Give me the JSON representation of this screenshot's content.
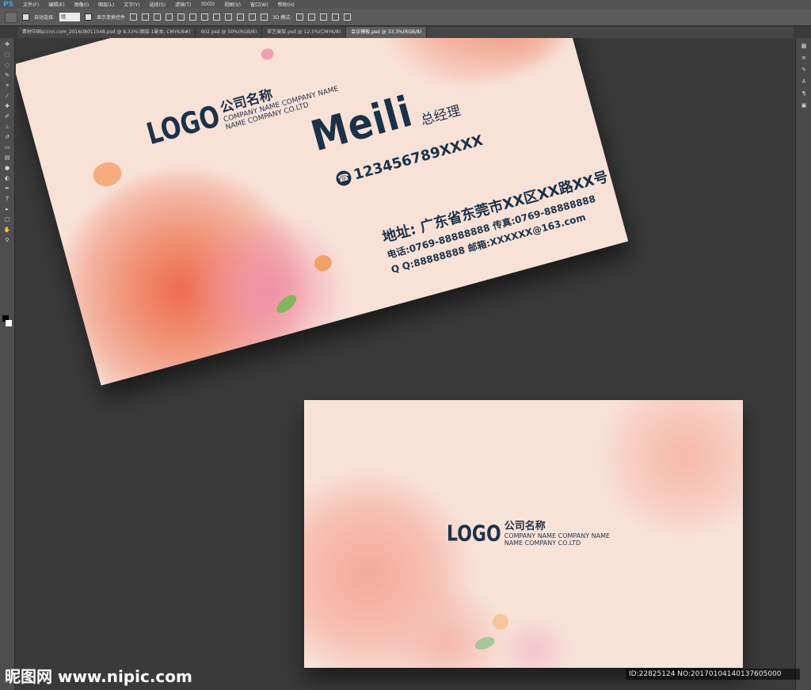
{
  "app": {
    "logo": "PS"
  },
  "menu": [
    "文件(F)",
    "编辑(E)",
    "图像(I)",
    "图层(L)",
    "文字(Y)",
    "选择(S)",
    "滤镜(T)",
    "3D(D)",
    "视图(V)",
    "窗口(W)",
    "帮助(H)"
  ],
  "options": {
    "auto_select_label": "自动选择:",
    "auto_select_value": "组",
    "show_transform_label": "显示变换控件",
    "mode_3d_label": "3D 模式:"
  },
  "tabs": [
    "素材中国sccnn.com_201608011048.psd @ 8.33%(图层 1副本, CMYK/8#)",
    "002.psd @ 50%(RGB/8)",
    "茶艺展架.psd @ 12.5%(CMYK/8)",
    "会议模板.psd @ 33.3%(RGB/8)"
  ],
  "active_tab": 3,
  "card_front": {
    "logo": "LOGO",
    "company_cn": "公司名称",
    "company_en_1": "COMPANY NAME COMPANY NAME",
    "company_en_2": "NAME COMPANY CO.LTD",
    "person_name": "Meili",
    "person_title": "总经理",
    "phone": "123456789XXXX",
    "address": "地址: 广东省东莞市XX区XX路XX号",
    "tel_fax": "电话:0769-88888888  传真:0769-88888888",
    "qq_email": "Q Q:88888888   邮箱:XXXXXX@163.com"
  },
  "card_back": {
    "logo": "LOGO",
    "company_cn": "公司名称",
    "company_en_1": "COMPANY NAME COMPANY NAME",
    "company_en_2": "NAME COMPANY CO.LTD"
  },
  "watermark": "昵图网 www.nipic.com",
  "image_id": "ID:22825124 NO:20170104140137605000",
  "colors": {
    "card_bg": "#f8e2d8",
    "text_navy": "#1a3148",
    "ps_ui": "#535353"
  }
}
